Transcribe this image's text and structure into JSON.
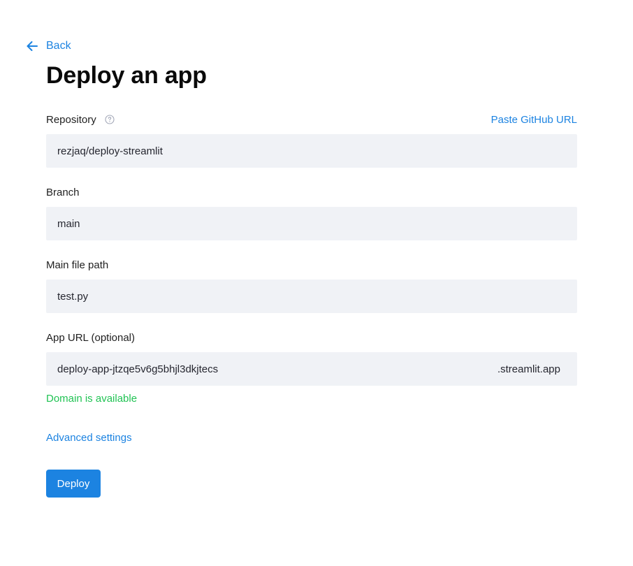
{
  "nav": {
    "back_label": "Back",
    "back_icon": "arrow-left-icon"
  },
  "page": {
    "title": "Deploy an app"
  },
  "repository": {
    "label": "Repository",
    "help_icon": "question-circle-icon",
    "paste_link": "Paste GitHub URL",
    "value": "rezjaq/deploy-streamlit"
  },
  "branch": {
    "label": "Branch",
    "value": "main"
  },
  "main_file": {
    "label": "Main file path",
    "value": "test.py"
  },
  "app_url": {
    "label": "App URL (optional)",
    "value": "deploy-app-jtzqe5v6g5bhjl3dkjtecs",
    "suffix": ".streamlit.app",
    "status": "Domain is available"
  },
  "advanced": {
    "label": "Advanced settings"
  },
  "actions": {
    "deploy_label": "Deploy"
  },
  "colors": {
    "accent": "#1c83e1",
    "success": "#21c354",
    "input_bg": "#f0f2f6"
  }
}
